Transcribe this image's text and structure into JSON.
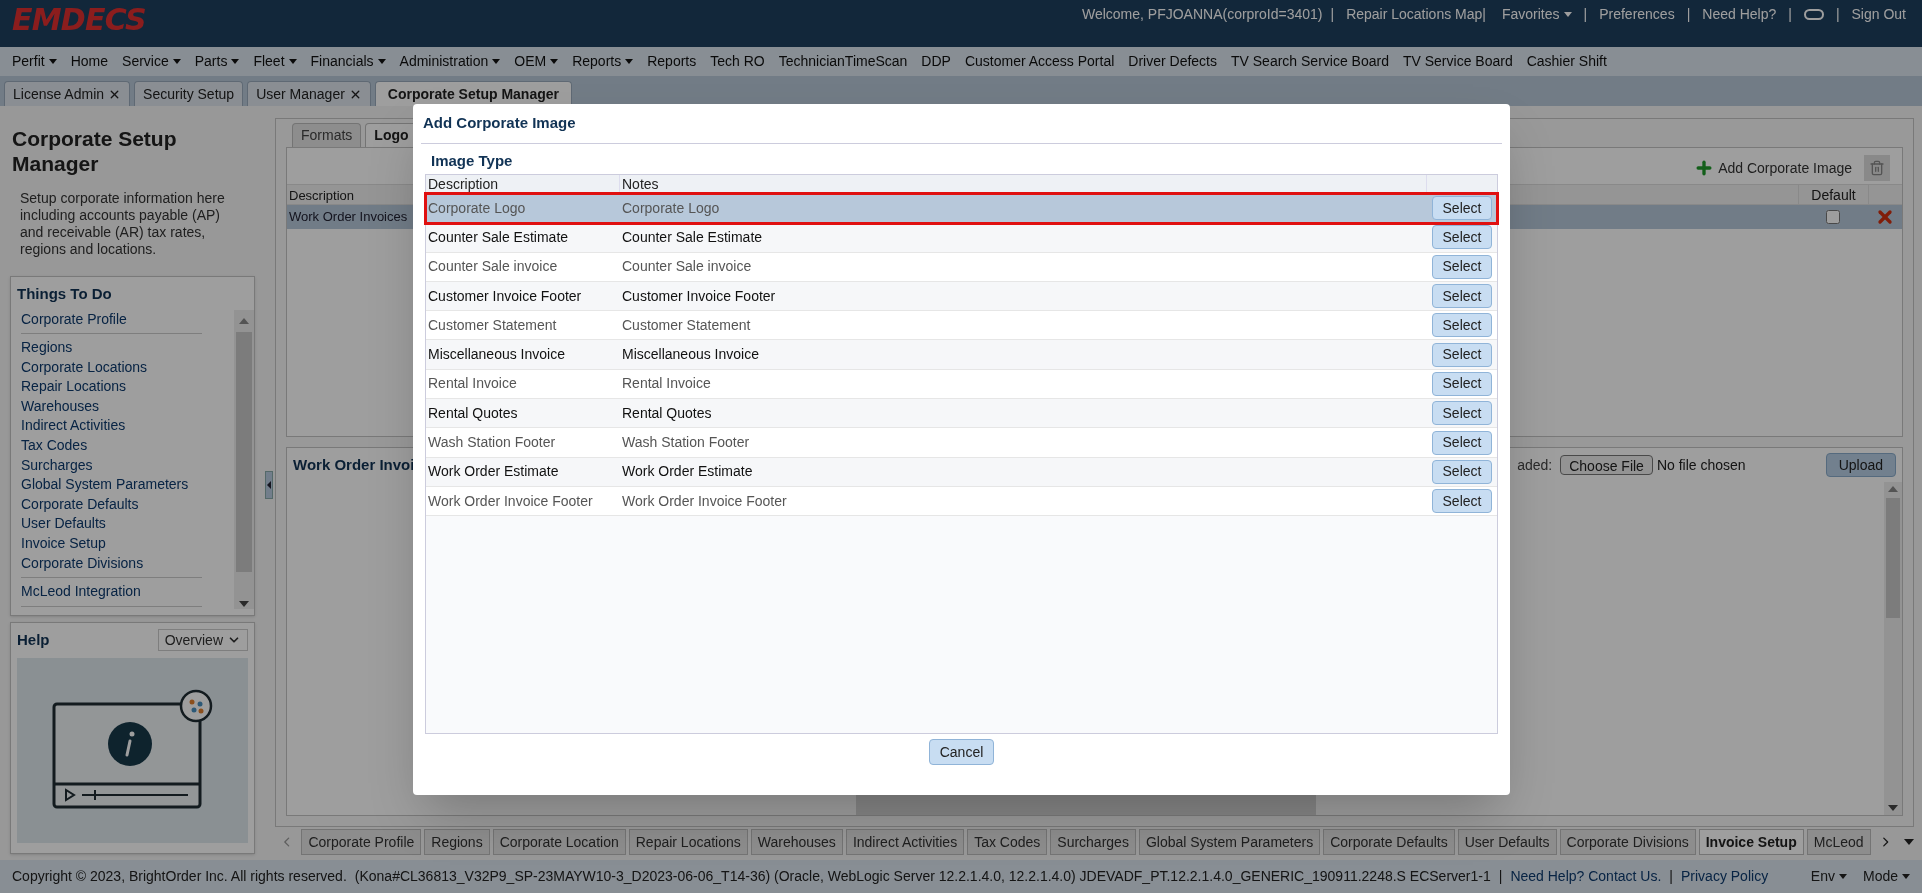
{
  "header": {
    "logo": "EMDECS",
    "links": [
      {
        "kind": "text",
        "label": "Welcome, PFJOANNA(corproId=3401)"
      },
      {
        "kind": "sep",
        "label": "|"
      },
      {
        "kind": "link",
        "label": "Repair Locations Map|"
      },
      {
        "kind": "menu",
        "label": "Favorites"
      },
      {
        "kind": "sep",
        "label": "|"
      },
      {
        "kind": "link",
        "label": "Preferences"
      },
      {
        "kind": "sep",
        "label": "|"
      },
      {
        "kind": "link",
        "label": "Need Help?"
      },
      {
        "kind": "sep",
        "label": "|"
      },
      {
        "kind": "toggle"
      },
      {
        "kind": "sep",
        "label": "|"
      },
      {
        "kind": "link",
        "label": "Sign Out"
      }
    ]
  },
  "menu_bar": [
    {
      "label": "Perfit",
      "dropdown": true
    },
    {
      "label": "Home",
      "dropdown": false
    },
    {
      "label": "Service",
      "dropdown": true
    },
    {
      "label": "Parts",
      "dropdown": true
    },
    {
      "label": "Fleet",
      "dropdown": true
    },
    {
      "label": "Financials",
      "dropdown": true
    },
    {
      "label": "Administration",
      "dropdown": true
    },
    {
      "label": "OEM",
      "dropdown": true
    },
    {
      "label": "Reports",
      "dropdown": true
    },
    {
      "label": "Reports",
      "dropdown": false
    },
    {
      "label": "Tech RO",
      "dropdown": false
    },
    {
      "label": "TechnicianTimeScan",
      "dropdown": false
    },
    {
      "label": "DDP",
      "dropdown": false
    },
    {
      "label": "Customer Access Portal",
      "dropdown": false
    },
    {
      "label": "Driver Defects",
      "dropdown": false
    },
    {
      "label": "TV Search Service Board",
      "dropdown": false
    },
    {
      "label": "TV Service Board",
      "dropdown": false
    },
    {
      "label": "Cashier Shift",
      "dropdown": false
    }
  ],
  "page_tabs": [
    {
      "label": "License Admin",
      "selected": false,
      "closable": true
    },
    {
      "label": "Security Setup",
      "selected": false,
      "closable": false
    },
    {
      "label": "User Manager",
      "selected": false,
      "closable": true
    },
    {
      "label": "Corporate Setup Manager",
      "selected": true,
      "closable": false
    }
  ],
  "sidebar": {
    "title": "Corporate Setup Manager",
    "description": "Setup corporate information here including accounts payable (AP) and receivable (AR) tax rates, regions and locations.",
    "things_to_do": {
      "title": "Things To Do",
      "groups": [
        [
          "Corporate Profile"
        ],
        [
          "Regions",
          "Corporate Locations",
          "Repair Locations",
          "Warehouses",
          "Indirect Activities",
          "Tax Codes",
          "Surcharges",
          "Global System Parameters",
          "Corporate Defaults",
          "User Defaults",
          "Invoice Setup",
          "Corporate Divisions"
        ],
        [
          "McLeod Integration"
        ]
      ]
    },
    "help": {
      "title": "Help",
      "select": "Overview"
    }
  },
  "content": {
    "tabs": [
      {
        "label": "Formats",
        "selected": false
      },
      {
        "label": "Logo",
        "selected": true
      }
    ],
    "add_button": "Add Corporate Image",
    "table": {
      "columns": [
        "Description",
        "Default"
      ],
      "rows": [
        {
          "description": "Work Order Invoices",
          "default": false,
          "selected": true
        }
      ]
    },
    "detail": {
      "heading": "Work Order Invoi",
      "upload_label": "aded:",
      "choose_file": "Choose File",
      "file_status": "No file chosen",
      "upload": "Upload"
    }
  },
  "bottom_tabs": [
    {
      "label": "Corporate Profile",
      "selected": false
    },
    {
      "label": "Regions",
      "selected": false
    },
    {
      "label": "Corporate Location",
      "selected": false
    },
    {
      "label": "Repair Locations",
      "selected": false
    },
    {
      "label": "Warehouses",
      "selected": false
    },
    {
      "label": "Indirect Activities",
      "selected": false
    },
    {
      "label": "Tax Codes",
      "selected": false
    },
    {
      "label": "Surcharges",
      "selected": false
    },
    {
      "label": "Global System Parameters",
      "selected": false
    },
    {
      "label": "Corporate Defaults",
      "selected": false
    },
    {
      "label": "User Defaults",
      "selected": false
    },
    {
      "label": "Corporate Divisions",
      "selected": false
    },
    {
      "label": "Invoice Setup",
      "selected": true
    },
    {
      "label": "McLeod",
      "selected": false
    }
  ],
  "footer": {
    "items": [
      {
        "kind": "text",
        "label": "Copyright © 2023, BrightOrder Inc. All rights reserved."
      },
      {
        "kind": "text",
        "label": "(Kona#CL36813_V32P9_SP-23MAYW10-3_D2023-06-06_T14-36) (Oracle, WebLogic Server 12.2.1.4.0, 12.2.1.4.0) JDEVADF_PT.12.2.1.4.0_GENERIC_190911.2248.S ECServer1-1"
      },
      {
        "kind": "sep",
        "label": "|"
      },
      {
        "kind": "link",
        "label": "Need Help? Contact Us."
      },
      {
        "kind": "sep",
        "label": "|"
      },
      {
        "kind": "link",
        "label": "Privacy Policy"
      }
    ],
    "menus": [
      "Env",
      "Mode"
    ]
  },
  "dialog": {
    "title": "Add Corporate Image",
    "section": "Image Type",
    "columns": [
      "Description",
      "Notes"
    ],
    "cancel": "Cancel",
    "rows": [
      {
        "description": "Corporate Logo",
        "notes": "Corporate Logo",
        "selected": true,
        "action": "Select"
      },
      {
        "description": "Counter Sale Estimate",
        "notes": "Counter Sale Estimate",
        "selected": false,
        "action": "Select"
      },
      {
        "description": "Counter Sale invoice",
        "notes": "Counter Sale invoice",
        "selected": false,
        "action": "Select"
      },
      {
        "description": "Customer Invoice Footer",
        "notes": "Customer Invoice Footer",
        "selected": false,
        "action": "Select"
      },
      {
        "description": "Customer Statement",
        "notes": "Customer Statement",
        "selected": false,
        "action": "Select"
      },
      {
        "description": "Miscellaneous Invoice",
        "notes": "Miscellaneous Invoice",
        "selected": false,
        "action": "Select"
      },
      {
        "description": "Rental Invoice",
        "notes": "Rental Invoice",
        "selected": false,
        "action": "Select"
      },
      {
        "description": "Rental Quotes",
        "notes": "Rental Quotes",
        "selected": false,
        "action": "Select"
      },
      {
        "description": "Wash Station Footer",
        "notes": "Wash Station Footer",
        "selected": false,
        "action": "Select"
      },
      {
        "description": "Work Order Estimate",
        "notes": "Work Order Estimate",
        "selected": false,
        "action": "Select"
      },
      {
        "description": "Work Order Invoice Footer",
        "notes": "Work Order Invoice Footer",
        "selected": false,
        "action": "Select"
      }
    ]
  }
}
